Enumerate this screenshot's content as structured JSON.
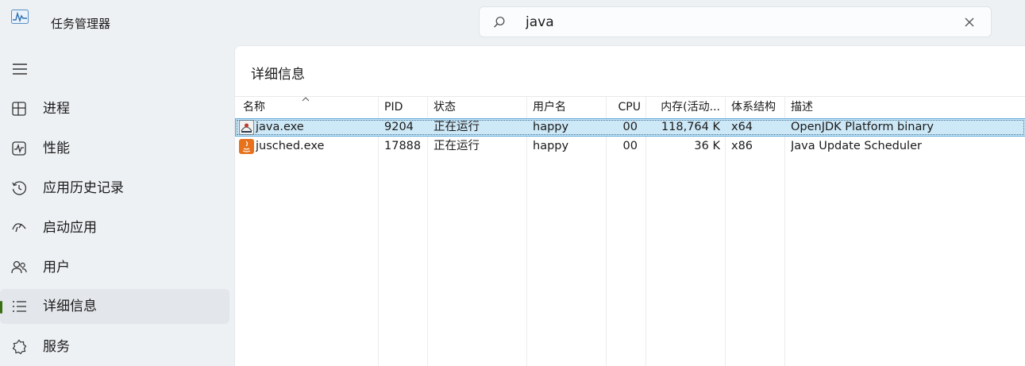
{
  "window": {
    "title": "任务管理器"
  },
  "search": {
    "value": "java",
    "icon": "search-icon",
    "clear_icon": "close-icon"
  },
  "sidebar": {
    "menu_icon": "hamburger-icon",
    "items": [
      {
        "label": "进程",
        "icon": "processes-icon"
      },
      {
        "label": "性能",
        "icon": "performance-icon"
      },
      {
        "label": "应用历史记录",
        "icon": "history-icon"
      },
      {
        "label": "启动应用",
        "icon": "startup-icon"
      },
      {
        "label": "用户",
        "icon": "users-icon"
      },
      {
        "label": "详细信息",
        "icon": "details-icon",
        "active": true
      },
      {
        "label": "服务",
        "icon": "services-icon"
      }
    ],
    "accent_color": "#3a6e12"
  },
  "main": {
    "title": "详细信息",
    "columns": [
      "名称",
      "PID",
      "状态",
      "用户名",
      "CPU",
      "内存(活动...",
      "体系结构",
      "描述"
    ],
    "sorted_column": "名称",
    "rows": [
      {
        "name": "java.exe",
        "icon": "java-app-icon",
        "pid": "9204",
        "status": "正在运行",
        "user": "happy",
        "cpu": "00",
        "memory": "118,764 K",
        "arch": "x64",
        "description": "OpenJDK Platform binary",
        "selected": true
      },
      {
        "name": "jusched.exe",
        "icon": "java-update-icon",
        "pid": "17888",
        "status": "正在运行",
        "user": "happy",
        "cpu": "00",
        "memory": "36 K",
        "arch": "x86",
        "description": "Java Update Scheduler",
        "selected": false
      }
    ],
    "selection_color": "#cde8f7"
  }
}
